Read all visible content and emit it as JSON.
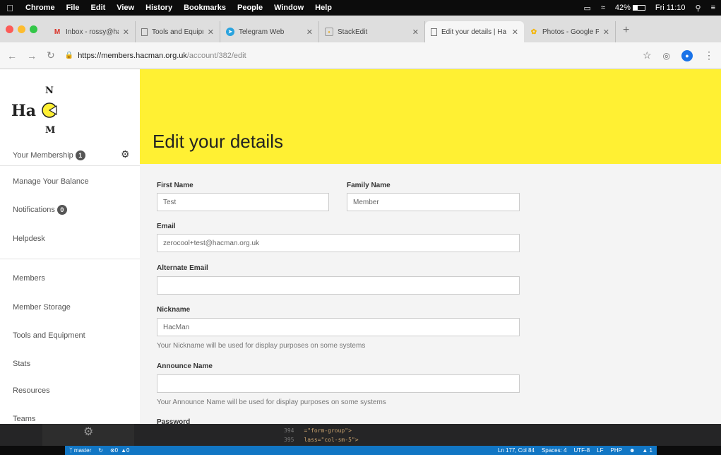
{
  "menubar": {
    "items": [
      "Chrome",
      "File",
      "Edit",
      "View",
      "History",
      "Bookmarks",
      "People",
      "Window",
      "Help"
    ],
    "battery": "42%",
    "clock": "Fri 11:10"
  },
  "tabs": [
    {
      "title": "Inbox - rossy@hacma",
      "favicon": "gmail-icon"
    },
    {
      "title": "Tools and Equipment",
      "favicon": "page-icon"
    },
    {
      "title": "Telegram Web",
      "favicon": "telegram-icon"
    },
    {
      "title": "StackEdit",
      "favicon": "stackedit-icon"
    },
    {
      "title": "Edit your details | Ha",
      "favicon": "page-icon"
    },
    {
      "title": "Photos - Google Pho",
      "favicon": "photos-icon"
    }
  ],
  "address_bar": {
    "host": "https://members.hacman.org.uk",
    "path": "/account/382/edit"
  },
  "sidebar": {
    "logo_text": "Ha",
    "items": [
      {
        "label": "Your Membership",
        "badge": "1"
      },
      {
        "label": "Manage Your Balance"
      },
      {
        "label": "Notifications",
        "badge": "0"
      },
      {
        "label": "Helpdesk"
      },
      {
        "label": "Members"
      },
      {
        "label": "Member Storage"
      },
      {
        "label": "Tools and Equipment"
      },
      {
        "label": "Stats"
      },
      {
        "label": "Resources"
      },
      {
        "label": "Teams"
      }
    ]
  },
  "page": {
    "title": "Edit your details",
    "form": {
      "first_name_label": "First Name",
      "first_name_value": "Test",
      "family_name_label": "Family Name",
      "family_name_value": "Member",
      "email_label": "Email",
      "email_value": "zerocool+test@hacman.org.uk",
      "alt_email_label": "Alternate Email",
      "alt_email_value": "",
      "nickname_label": "Nickname",
      "nickname_value": "HacMan",
      "nickname_help": "Your Nickname will be used for display purposes on some systems",
      "announce_label": "Announce Name",
      "announce_value": "",
      "announce_help": "Your Announce Name will be used for display purposes on some systems",
      "password_label": "Password"
    }
  },
  "editor": {
    "lines": [
      {
        "num": "394",
        "code": "=\"form-group\">"
      },
      {
        "num": "395",
        "code": "lass=\"col-sm-5\">"
      }
    ]
  },
  "statusbar": {
    "branch": "master",
    "errors": "0",
    "warnings": "0",
    "position": "Ln 177, Col 84",
    "spaces": "Spaces: 4",
    "encoding": "UTF-8",
    "eol": "LF",
    "language": "PHP",
    "notifications": "1"
  },
  "colors": {
    "hero": "#fff033",
    "status_blue": "#1176c4"
  }
}
